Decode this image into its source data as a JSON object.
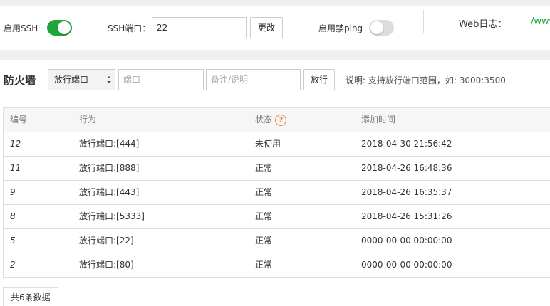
{
  "ssh": {
    "enable_label": "启用SSH",
    "enabled": true,
    "port_label": "SSH端口：",
    "port_value": "22",
    "change_button": "更改",
    "ping_label": "启用禁ping",
    "ping_enabled": false,
    "weblog_label": "Web日志：",
    "weblog_path": "/www"
  },
  "firewall": {
    "title": "防火墙",
    "type_select": "放行端口",
    "port_placeholder": "端口",
    "note_placeholder": "备注/说明",
    "allow_button": "放行",
    "hint": "说明: 支持放行端口范围，如: 3000:3500"
  },
  "table": {
    "headers": {
      "id": "编号",
      "action": "行为",
      "status": "状态",
      "time": "添加时间"
    },
    "help_icon": "?",
    "rows": [
      {
        "id": "12",
        "action": "放行端口:[444]",
        "status": "未使用",
        "time": "2018-04-30 21:56:42"
      },
      {
        "id": "11",
        "action": "放行端口:[888]",
        "status": "正常",
        "time": "2018-04-26 16:48:36"
      },
      {
        "id": "9",
        "action": "放行端口:[443]",
        "status": "正常",
        "time": "2018-04-26 16:35:37"
      },
      {
        "id": "8",
        "action": "放行端口:[5333]",
        "status": "正常",
        "time": "2018-04-26 15:31:26"
      },
      {
        "id": "5",
        "action": "放行端口:[22]",
        "status": "正常",
        "time": "0000-00-00 00:00:00"
      },
      {
        "id": "2",
        "action": "放行端口:[80]",
        "status": "正常",
        "time": "0000-00-00 00:00:00"
      }
    ]
  },
  "pager": {
    "total": "共6条数据"
  },
  "colors": {
    "accent": "#20a53a",
    "help": "#e8822f"
  }
}
